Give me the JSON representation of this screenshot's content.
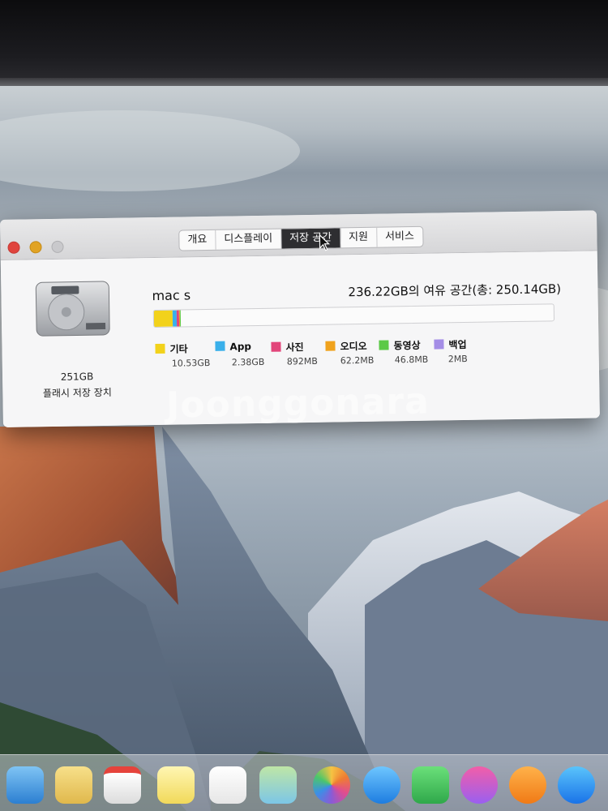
{
  "window": {
    "tabs": [
      {
        "label": "개요",
        "active": false
      },
      {
        "label": "디스플레이",
        "active": false
      },
      {
        "label": "저장 공간",
        "active": true
      },
      {
        "label": "지원",
        "active": false
      },
      {
        "label": "서비스",
        "active": false
      }
    ]
  },
  "storage": {
    "drive_size": "251GB",
    "drive_type": "플래시 저장 장치",
    "volume_name": "mac s",
    "available_text": "236.22GB의 여유 공간(총: 250.14GB)",
    "categories": [
      {
        "label": "기타",
        "size": "10.53GB",
        "color": "#f2d21b"
      },
      {
        "label": "App",
        "size": "2.38GB",
        "color": "#3ab0ea"
      },
      {
        "label": "사진",
        "size": "892MB",
        "color": "#e2457a"
      },
      {
        "label": "오디오",
        "size": "62.2MB",
        "color": "#f0a21c"
      },
      {
        "label": "동영상",
        "size": "46.8MB",
        "color": "#5cc947"
      },
      {
        "label": "백업",
        "size": "2MB",
        "color": "#a48de6"
      }
    ]
  },
  "watermark": "Joonggonara",
  "dock": {
    "icons": [
      "finder-icon",
      "notes-icon",
      "calendar-icon",
      "stickies-icon",
      "reminders-icon",
      "maps-icon",
      "photos-icon",
      "messages-icon",
      "facetime-icon",
      "itunes-icon",
      "ibooks-icon",
      "app-store-icon"
    ]
  }
}
